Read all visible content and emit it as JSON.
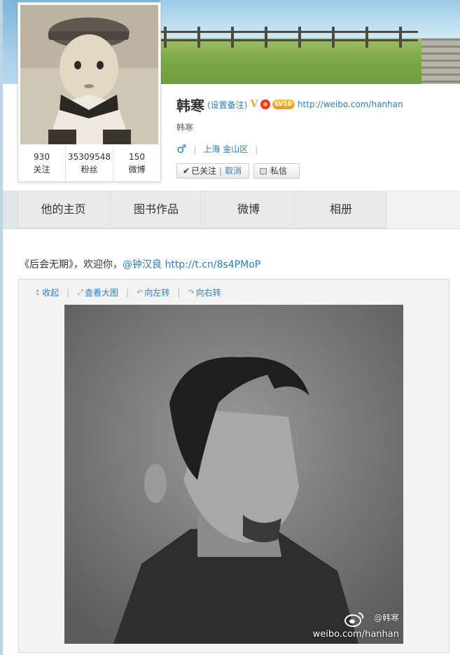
{
  "profile": {
    "name": "韩寒",
    "remark_label": "(设置备注)",
    "v_badge": "V",
    "level_badge": "LV10",
    "homepage_url": "http://weibo.com/hanhan",
    "intro": "韩寒",
    "gender_symbol": "♂",
    "location": "上海 金山区",
    "separator": "|"
  },
  "stats": [
    {
      "count": "930",
      "label": "关注"
    },
    {
      "count": "35309548",
      "label": "粉丝"
    },
    {
      "count": "150",
      "label": "微博"
    }
  ],
  "actions": {
    "followed_label": "已关注",
    "followed_separator": "|",
    "cancel_label": "取消",
    "message_label": "私信"
  },
  "tabs": [
    {
      "label": "他的主页"
    },
    {
      "label": "图书作品"
    },
    {
      "label": "微博"
    },
    {
      "label": "相册"
    }
  ],
  "post": {
    "text": "《后会无期》，欢迎你，",
    "mention": "@钟汉良",
    "url": " http://t.cn/8s4PMoP"
  },
  "media_tools": {
    "collapse": "收起",
    "view_large": "查看大图",
    "rotate_left": "向左转",
    "rotate_right": "向右转",
    "separator": "|"
  },
  "watermark": {
    "handle": "@韩寒",
    "url": "weibo.com/hanhan"
  },
  "colors": {
    "link": "#2d7ec0",
    "tab_bg": "#eaeaea",
    "level_badge": "#e79a14"
  }
}
